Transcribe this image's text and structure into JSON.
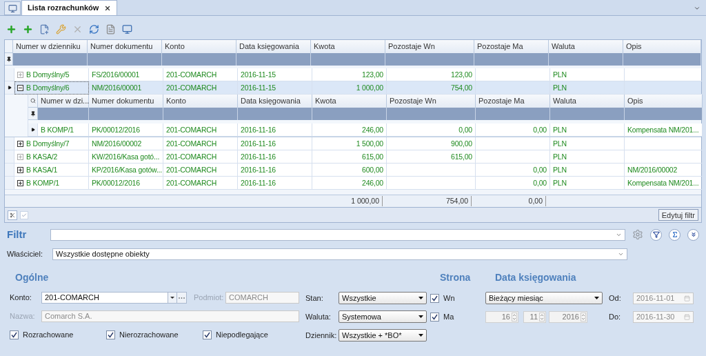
{
  "tabs": [
    {
      "label": "Lista rozrachunków",
      "selected": true
    }
  ],
  "grid": {
    "columns": [
      "Numer w dzienniku",
      "Numer dokumentu",
      "Konto",
      "Data księgowania",
      "Kwota",
      "Pozostaje Wn",
      "Pozostaje Ma",
      "Waluta",
      "Opis"
    ],
    "rows": [
      {
        "selected": false,
        "expanded": false,
        "has_children": false,
        "journal_no": "B Domyślny/5",
        "document_no": "FS/2016/00001",
        "account": "201-COMARCH",
        "posting_date": "2016-11-15",
        "amount": "123,00",
        "remaining_dr": "123,00",
        "currency": "PLN"
      },
      {
        "selected": true,
        "expanded": true,
        "has_children": true,
        "journal_no": "B Domyślny/6",
        "document_no": "NM/2016/00001",
        "account": "201-COMARCH",
        "posting_date": "2016-11-15",
        "amount": "1 000,00",
        "remaining_dr": "754,00",
        "currency": "PLN",
        "child_grid": {
          "columns": [
            "Numer w dzi...",
            "Numer dokumentu",
            "Konto",
            "Data księgowania",
            "Kwota",
            "Pozostaje Wn",
            "Pozostaje Ma",
            "Waluta",
            "Opis"
          ],
          "rows": [
            {
              "selected": true,
              "journal_no": "B KOMP/1",
              "document_no": "PK/00012/2016",
              "account": "201-COMARCH",
              "posting_date": "2016-11-16",
              "amount": "246,00",
              "remaining_dr": "0,00",
              "remaining_cr": "0,00",
              "currency": "PLN",
              "description": "Kompensata NM/201..."
            }
          ]
        }
      },
      {
        "selected": false,
        "expanded": false,
        "has_children": true,
        "journal_no": "B Domyślny/7",
        "document_no": "NM/2016/00002",
        "account": "201-COMARCH",
        "posting_date": "2016-11-16",
        "amount": "1 500,00",
        "remaining_dr": "900,00",
        "currency": "PLN"
      },
      {
        "selected": false,
        "expanded": false,
        "has_children": false,
        "journal_no": "B KASA/2",
        "document_no": "KW/2016/Kasa gotó...",
        "account": "201-COMARCH",
        "posting_date": "2016-11-16",
        "amount": "615,00",
        "remaining_dr": "615,00",
        "currency": "PLN"
      },
      {
        "selected": false,
        "expanded": false,
        "has_children": true,
        "journal_no": "B KASA/1",
        "document_no": "KP/2016/Kasa gotów...",
        "account": "201-COMARCH",
        "posting_date": "2016-11-16",
        "amount": "600,00",
        "remaining_cr": "0,00",
        "currency": "PLN",
        "description": "NM/2016/00002"
      },
      {
        "selected": false,
        "expanded": false,
        "has_children": true,
        "journal_no": "B KOMP/1",
        "document_no": "PK/00012/2016",
        "account": "201-COMARCH",
        "posting_date": "2016-11-16",
        "amount": "246,00",
        "remaining_cr": "0,00",
        "currency": "PLN",
        "description": "Kompensata NM/201..."
      }
    ],
    "totals": {
      "amount": "1 000,00",
      "remaining_dr": "754,00",
      "remaining_cr": "0,00"
    }
  },
  "edit_filter_button": "Edytuj filtr",
  "filter": {
    "label": "Filtr",
    "owner_label": "Właściciel:",
    "owner_value": "Wszystkie dostępne obiekty"
  },
  "general": {
    "heading": "Ogólne",
    "account": {
      "label": "Konto:",
      "value": "201-COMARCH"
    },
    "subject": {
      "label": "Podmiot:",
      "value": "COMARCH",
      "disabled": true
    },
    "name": {
      "label": "Nazwa:",
      "value": "Comarch S.A.",
      "disabled": true
    },
    "checkboxes": [
      {
        "label": "Rozrachowane",
        "checked": true
      },
      {
        "label": "Nierozrachowane",
        "checked": true
      },
      {
        "label": "Niepodlegające",
        "checked": true
      }
    ],
    "state": {
      "label": "Stan:",
      "value": "Wszystkie"
    },
    "currency": {
      "label": "Waluta:",
      "value": "Systemowa"
    },
    "journal": {
      "label": "Dziennik:",
      "value": "Wszystkie + *BO*"
    }
  },
  "side": {
    "heading": "Strona",
    "options": [
      {
        "label": "Wn",
        "checked": true
      },
      {
        "label": "Ma",
        "checked": true
      }
    ]
  },
  "posting_date": {
    "heading": "Data księgowania",
    "period": "Bieżący miesiąc",
    "date_parts": [
      {
        "value": "16",
        "disabled": true
      },
      {
        "value": "11",
        "disabled": true
      },
      {
        "value": "2016",
        "disabled": true
      }
    ],
    "from": {
      "label": "Od:",
      "value": "2016-11-01",
      "disabled": true
    },
    "to": {
      "label": "Do:",
      "value": "2016-11-30",
      "disabled": true
    }
  }
}
